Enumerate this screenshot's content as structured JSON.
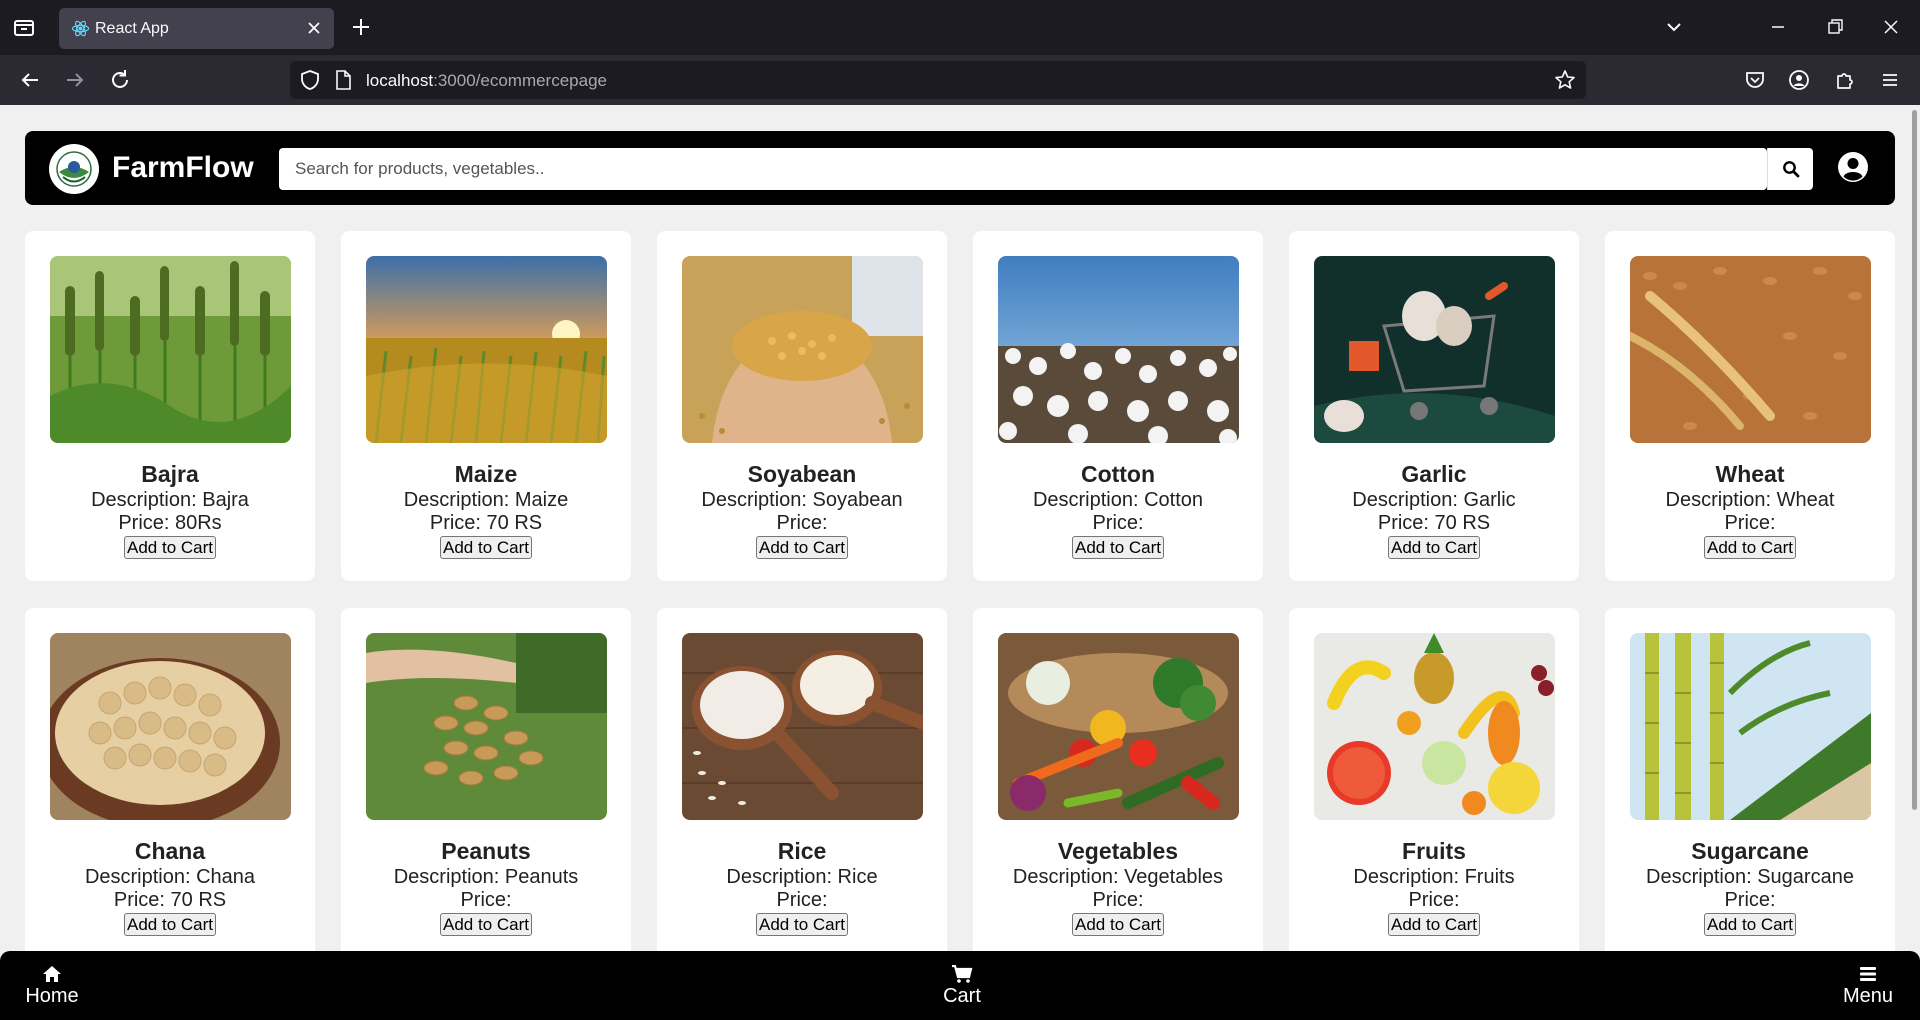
{
  "browser": {
    "tab_title": "React App",
    "url_host": "localhost",
    "url_path": ":3000/ecommercepage"
  },
  "header": {
    "brand": "FarmFlow",
    "search_placeholder": "Search for products, vegetables.."
  },
  "products": [
    {
      "name": "Bajra",
      "description": "Description: Bajra",
      "price": "Price: 80Rs",
      "button": "Add to Cart"
    },
    {
      "name": "Maize",
      "description": "Description: Maize",
      "price": "Price: 70 RS",
      "button": "Add to Cart"
    },
    {
      "name": "Soyabean",
      "description": "Description: Soyabean",
      "price": "Price:",
      "button": "Add to Cart"
    },
    {
      "name": "Cotton",
      "description": "Description: Cotton",
      "price": "Price:",
      "button": "Add to Cart"
    },
    {
      "name": "Garlic",
      "description": "Description: Garlic",
      "price": "Price: 70 RS",
      "button": "Add to Cart"
    },
    {
      "name": "Wheat",
      "description": "Description: Wheat",
      "price": "Price:",
      "button": "Add to Cart"
    },
    {
      "name": "Chana",
      "description": "Description: Chana",
      "price": "Price: 70 RS",
      "button": "Add to Cart"
    },
    {
      "name": "Peanuts",
      "description": "Description: Peanuts",
      "price": "Price:",
      "button": "Add to Cart"
    },
    {
      "name": "Rice",
      "description": "Description: Rice",
      "price": "Price:",
      "button": "Add to Cart"
    },
    {
      "name": "Vegetables",
      "description": "Description: Vegetables",
      "price": "Price:",
      "button": "Add to Cart"
    },
    {
      "name": "Fruits",
      "description": "Description: Fruits",
      "price": "Price:",
      "button": "Add to Cart"
    },
    {
      "name": "Sugarcane",
      "description": "Description: Sugarcane",
      "price": "Price:",
      "button": "Add to Cart"
    }
  ],
  "bottom_nav": {
    "home": "Home",
    "cart": "Cart",
    "menu": "Menu"
  }
}
